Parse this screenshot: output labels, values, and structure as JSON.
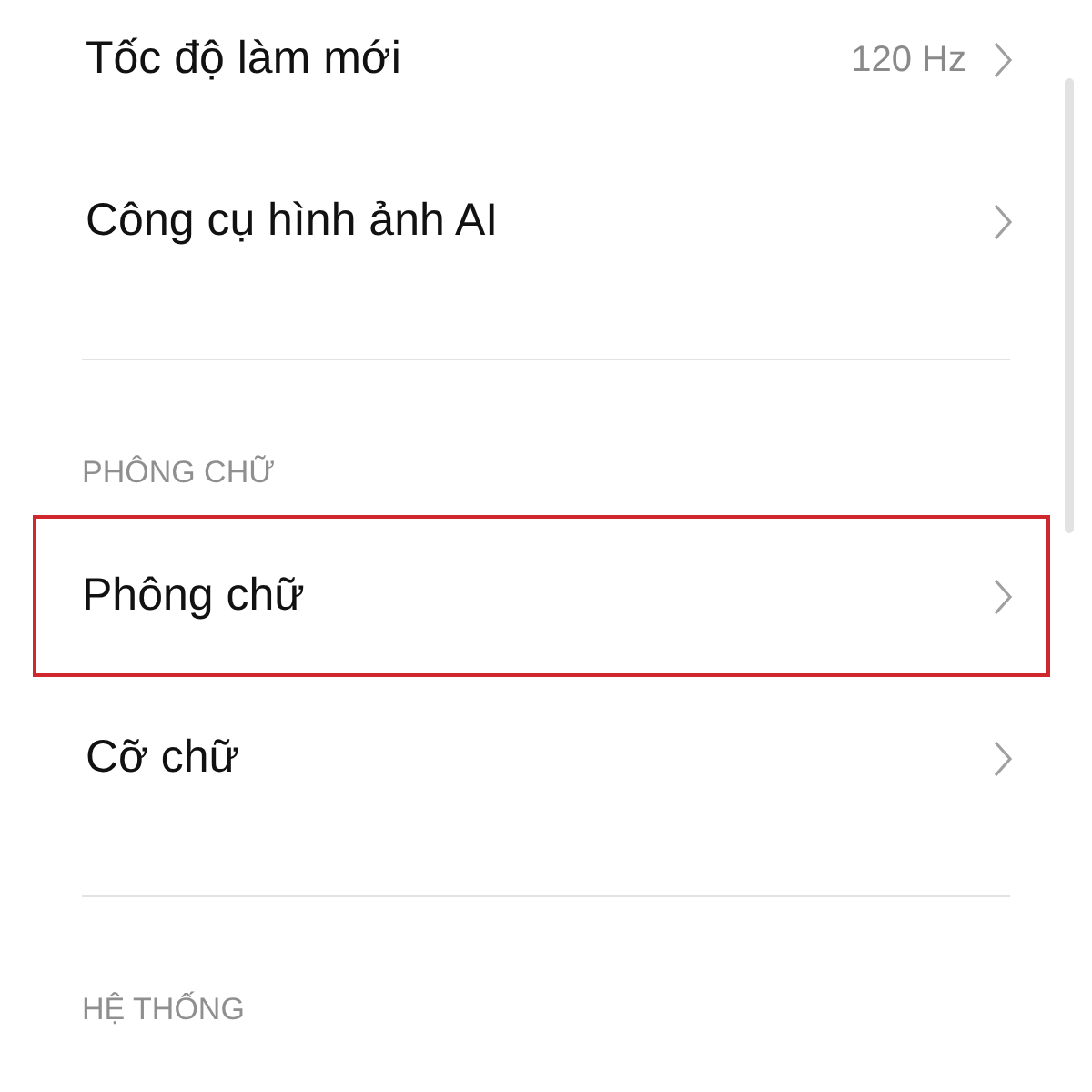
{
  "sections": [
    {
      "items": [
        {
          "label": "Tốc độ làm mới",
          "value": "120 Hz",
          "highlighted": false
        },
        {
          "label": "Công cụ hình ảnh AI",
          "highlighted": false
        }
      ]
    },
    {
      "header": "PHÔNG CHỮ",
      "items": [
        {
          "label": "Phông chữ",
          "highlighted": true
        },
        {
          "label": "Cỡ chữ",
          "highlighted": false
        }
      ]
    },
    {
      "header": "HỆ THỐNG"
    }
  ]
}
